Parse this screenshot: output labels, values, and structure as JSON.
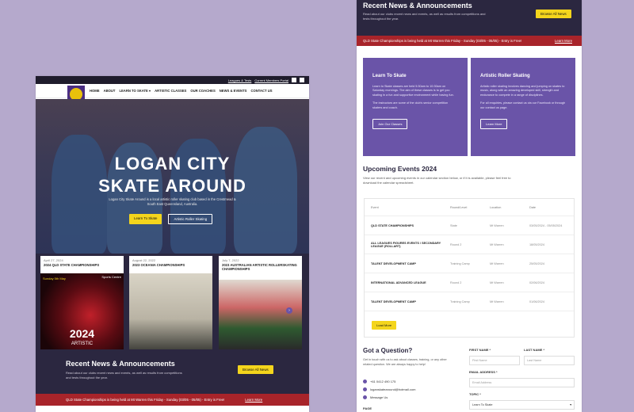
{
  "left": {
    "topbar": {
      "link1": "Leagues & Tests",
      "link2": "Current Members Portal"
    },
    "nav": [
      "HOME",
      "ABOUT",
      "LEARN TO SKATE ▾",
      "ARTISTIC CLASSES",
      "OUR COACHES",
      "NEWS & EVENTS",
      "CONTACT US"
    ],
    "hero": {
      "title1": "LOGAN CITY",
      "title2": "SKATE AROUND",
      "subtitle": "Logan City Skate Around is a local artistic roller skating club based in the Crestmead & South East Queensland, Australia.",
      "btn1": "Learn To Skate",
      "btn2": "Artistic Roller Skating"
    },
    "cards": [
      {
        "date": "April 27, 2024",
        "title": "2024 QLD STATE CHAMPIONSHIPS",
        "img_text": "2024",
        "img_sub": "ARTISTIC",
        "corner": "Sports Centre",
        "day": "Sunday 5th May"
      },
      {
        "date": "August 22, 2022",
        "title": "2023 OCEANIA CHAMPIONSHIPS"
      },
      {
        "date": "July 7, 2022",
        "title": "2023 AUSTRALIAN ARTISTIC ROLLERSKATING CHAMPIONSHIPS"
      }
    ],
    "news": {
      "title": "Recent News & Announcements",
      "desc": "Read about our clubs recent news and events, as well as results from competitions and tests throughout the year.",
      "btn": "Browse All News"
    },
    "banner": {
      "text": "QLD State Championships is being held at Mt Warren this Friday - Sunday (03/05 - 05/05) - Entry is Free!",
      "link": "Learn More"
    }
  },
  "right": {
    "news": {
      "title": "Recent News & Announcements",
      "desc": "Read about our clubs recent news and events, as well as results from competitions and tests throughout the year.",
      "btn": "Browse All News"
    },
    "banner": {
      "text": "QLD State Championships is being held at Mt Warren this Friday - Sunday (03/05 - 05/05) - Entry is Free!",
      "link": "Learn More"
    },
    "promo": [
      {
        "title": "Learn To Skate",
        "p1": "Learn to Skate classes are held 5:30am to 10:30am on Saturday mornings. The aim of these classes is to get you skating in a fun and supportive environment while having fun.",
        "p2": "The instructors are some of the club's senior competition skaters and coach.",
        "btn": "Join Our Classes"
      },
      {
        "title": "Artistic Roller Skating",
        "p1": "Artistic roller skating involves dancing and jumping on skates to music, along with an amazing developed skill, strength and endurance to compete in a range of disciplines.",
        "p2": "For all enquiries, please contact us via our Facebook or through our contact us page.",
        "btn": "Learn More"
      }
    ],
    "events": {
      "title": "Upcoming Events 2024",
      "desc": "View our recent and upcoming events in our calendar section below, or if it is available, please feel free to download the calendar spreadsheet.",
      "headers": [
        "Event",
        "Round/Level",
        "Location",
        "Date"
      ],
      "rows": [
        {
          "event": "QLD STATE CHAMPIONSHIPS",
          "round": "State",
          "loc": "Mt Warren",
          "date": "03/05/2024 - 05/05/2024"
        },
        {
          "event": "ALL LEAGUES FIGURES EVENTS / SECONDARY LEAGUE (ROLLART)",
          "round": "Round 2",
          "loc": "Mt Warren",
          "date": "18/05/2024"
        },
        {
          "event": "TALENT DEVELOPMENT CAMP",
          "round": "Training Camp",
          "loc": "Mt Warren",
          "date": "25/05/2024"
        },
        {
          "event": "INTERNATIONAL ADVANCED LEAGUE",
          "round": "Round 2",
          "loc": "Mt Warren",
          "date": "02/06/2024"
        },
        {
          "event": "TALENT DEVELOPMENT CAMP",
          "round": "Training Camp",
          "loc": "Mt Warren",
          "date": "01/06/2024"
        }
      ],
      "btn": "Load More"
    },
    "contact": {
      "title": "Got a Question?",
      "desc": "Get in touch with us to ask about classes, training, or any other related question. We are always happy to help!",
      "phone": "+61 0412 490 175",
      "email": "loganskatearound@hotmail.com",
      "msg": "Message Us",
      "labels": {
        "first": "FIRST NAME *",
        "last": "LAST NAME *",
        "email": "EMAIL ADDRESS *",
        "topic": "TOPIC *",
        "page": "PAGE"
      },
      "placeholders": {
        "first": "First Name",
        "last": "Last Name",
        "email": "Email Address"
      },
      "topic_value": "Learn To Skate"
    }
  },
  "colors": {
    "purple": "#6a54a8",
    "dark": "#2b2740",
    "yellow": "#f4d51c",
    "red": "#a8242a",
    "bg": "#b5a9cc"
  }
}
